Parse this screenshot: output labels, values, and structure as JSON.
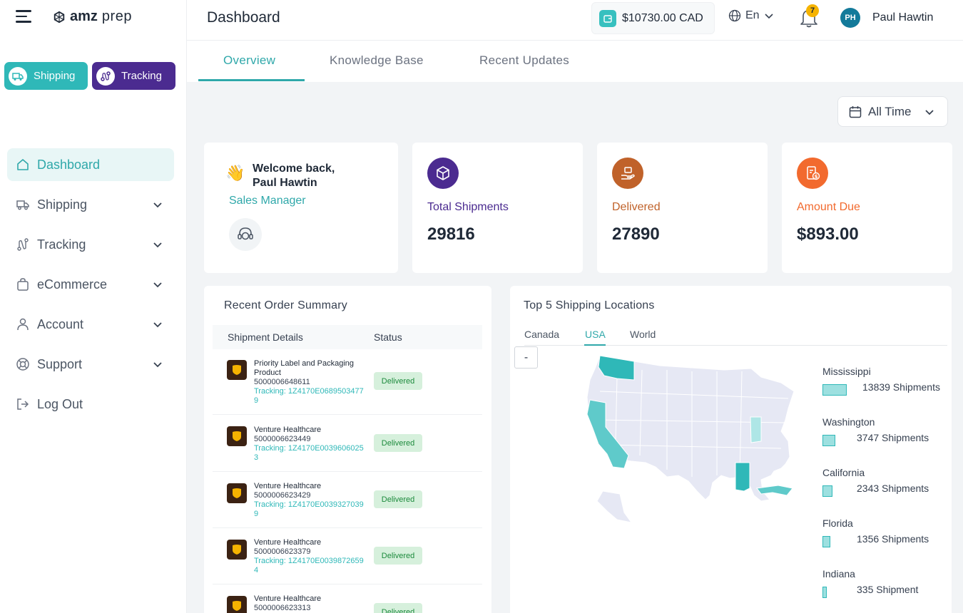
{
  "app": {
    "logo_bold": "amz",
    "logo_light": "prep"
  },
  "quick_actions": {
    "shipping": "Shipping",
    "tracking": "Tracking"
  },
  "sidebar": {
    "items": [
      {
        "label": "Dashboard",
        "icon": "home-icon",
        "active": true
      },
      {
        "label": "Shipping",
        "icon": "truck-icon"
      },
      {
        "label": "Tracking",
        "icon": "route-icon"
      },
      {
        "label": "eCommerce",
        "icon": "bag-icon"
      },
      {
        "label": "Account",
        "icon": "user-icon"
      },
      {
        "label": "Support",
        "icon": "lifebuoy-icon"
      },
      {
        "label": "Log Out",
        "icon": "logout-icon"
      }
    ]
  },
  "header": {
    "title": "Dashboard",
    "wallet_balance": "$10730.00 CAD",
    "language": "En",
    "notification_count": "7",
    "avatar_initials": "PH",
    "user_name": "Paul Hawtin"
  },
  "tabs": [
    "Overview",
    "Knowledge Base",
    "Recent Updates"
  ],
  "filter": {
    "label": "All Time"
  },
  "welcome": {
    "greeting_line1": "Welcome back,",
    "greeting_line2": "Paul Hawtin",
    "role": "Sales Manager"
  },
  "stats": [
    {
      "label": "Total Shipments",
      "value": "29816",
      "color": "#4b2b90"
    },
    {
      "label": "Delivered",
      "value": "27890",
      "color": "#c0622a"
    },
    {
      "label": "Amount Due",
      "value": "$893.00",
      "color": "#f26a2e"
    }
  ],
  "orders": {
    "title": "Recent Order Summary",
    "columns": [
      "Shipment Details",
      "Status"
    ],
    "rows": [
      {
        "name": "Priority Label and Packaging Product",
        "id": "5000006648611",
        "tracking": "Tracking: 1Z4170E06895034779",
        "status": "Delivered"
      },
      {
        "name": "Venture Healthcare",
        "id": "5000006623449",
        "tracking": "Tracking: 1Z4170E00396060253",
        "status": "Delivered"
      },
      {
        "name": "Venture Healthcare",
        "id": "5000006623429",
        "tracking": "Tracking: 1Z4170E00393270399",
        "status": "Delivered"
      },
      {
        "name": "Venture Healthcare",
        "id": "5000006623379",
        "tracking": "Tracking: 1Z4170E00398726594",
        "status": "Delivered"
      },
      {
        "name": "Venture Healthcare",
        "id": "5000006623313",
        "tracking": "",
        "status": "Delivered"
      }
    ]
  },
  "locations": {
    "title": "Top 5 Shipping Locations",
    "tabs": [
      "Canada",
      "USA",
      "World"
    ],
    "active_tab": "USA",
    "zoom_out": "-",
    "items": [
      {
        "name": "Mississippi",
        "count": 13839,
        "label": "13839 Shipments"
      },
      {
        "name": "Washington",
        "count": 3747,
        "label": "3747 Shipments"
      },
      {
        "name": "California",
        "count": 2343,
        "label": "2343 Shipments"
      },
      {
        "name": "Florida",
        "count": 1356,
        "label": "1356 Shipments"
      },
      {
        "name": "Indiana",
        "count": 335,
        "label": "335 Shipment"
      }
    ]
  },
  "colors": {
    "teal": "#2fb8b8",
    "purple": "#4b2b90",
    "brown": "#c0622a",
    "orange": "#f26a2e",
    "map_land": "#e6e8f4"
  }
}
